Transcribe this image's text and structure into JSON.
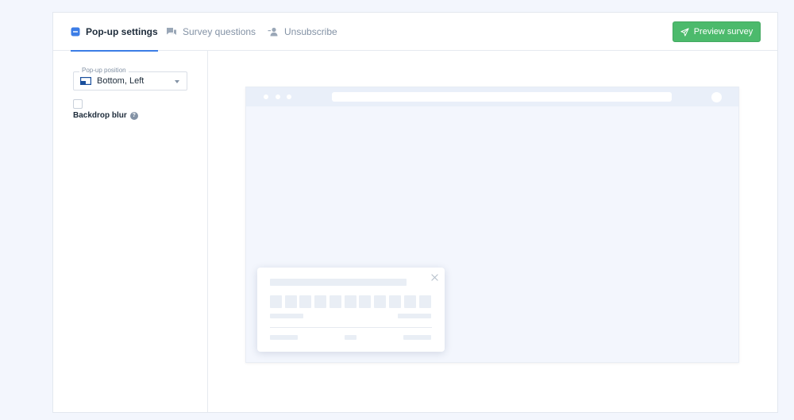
{
  "tabs": [
    {
      "label": "Pop-up settings",
      "icon": "square-minus-icon",
      "active": true
    },
    {
      "label": "Survey questions",
      "icon": "chat-bubbles-icon",
      "active": false
    },
    {
      "label": "Unsubscribe",
      "icon": "user-minus-icon",
      "active": false
    }
  ],
  "toolbar": {
    "preview_label": "Preview survey",
    "preview_icon": "send-icon"
  },
  "sidebar": {
    "position_legend": "Pop-up position",
    "position_value": "Bottom, Left",
    "position_icon": "layout-bottom-left-icon",
    "backdrop_label": "Backdrop blur",
    "backdrop_checked": false
  },
  "colors": {
    "accent": "#3c7de6",
    "success": "#4cba6c",
    "background": "#f3f6fd"
  }
}
